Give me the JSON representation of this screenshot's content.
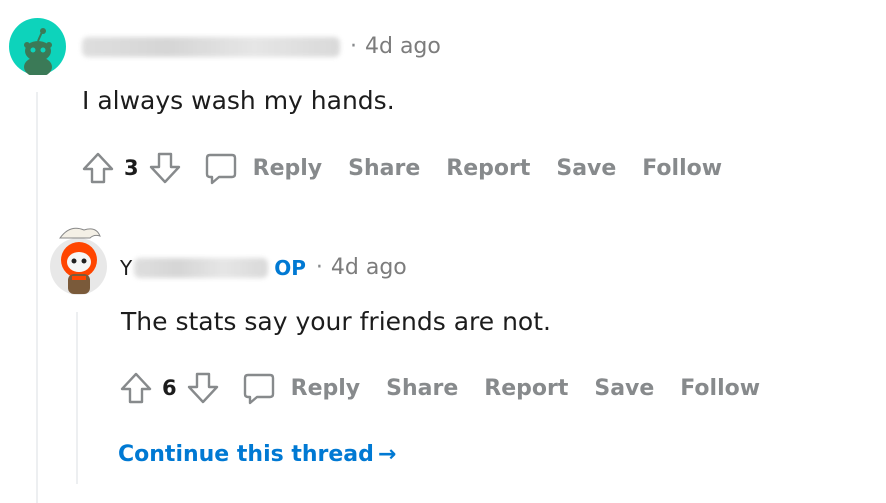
{
  "comments": [
    {
      "username": "Accomplished-Seat",
      "timestamp": "4d ago",
      "body": "I always wash my hands.",
      "score": "3",
      "actions": {
        "reply": "Reply",
        "share": "Share",
        "report": "Report",
        "save": "Save",
        "follow": "Follow"
      }
    },
    {
      "username": "Y",
      "op_badge": "OP",
      "timestamp": "4d ago",
      "body": "The stats say your friends are not.",
      "score": "6",
      "actions": {
        "reply": "Reply",
        "share": "Share",
        "report": "Report",
        "save": "Save",
        "follow": "Follow"
      }
    }
  ],
  "continue_thread": {
    "label": "Continue this thread",
    "arrow": "→"
  },
  "colors": {
    "accent": "#0079d3",
    "muted": "#878a8c",
    "avatar_bg": "#0dd3bb",
    "avatar_orange": "#ff4500"
  },
  "icons": [
    "upvote-icon",
    "downvote-icon",
    "comment-icon",
    "snoo-avatar-icon",
    "arrow-right-icon"
  ]
}
